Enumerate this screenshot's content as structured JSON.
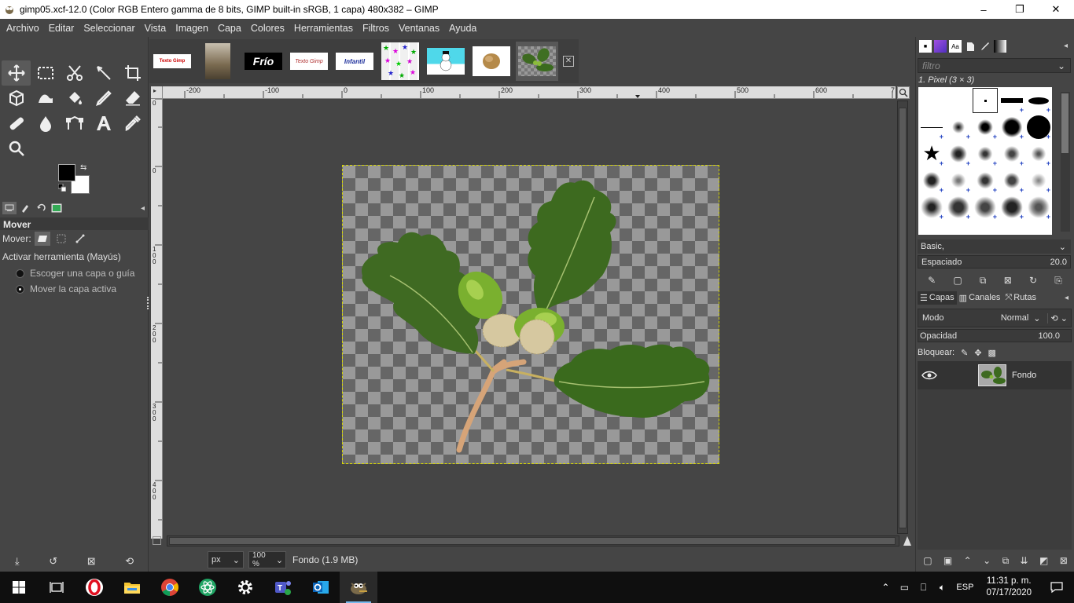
{
  "window": {
    "title": "gimp05.xcf-12.0 (Color RGB Entero gamma de 8 bits, GIMP built-in sRGB, 1 capa) 480x382 – GIMP",
    "minimize": "–",
    "maximize": "❐",
    "close": "✕"
  },
  "menu": [
    "Archivo",
    "Editar",
    "Seleccionar",
    "Vista",
    "Imagen",
    "Capa",
    "Colores",
    "Herramientas",
    "Filtros",
    "Ventanas",
    "Ayuda"
  ],
  "image_tabs": [
    {
      "label": "Texto Gimp",
      "bg": "#ffffff",
      "fg": "#cc0000"
    },
    {
      "label": "",
      "bg": "#8a7a60",
      "fg": "#fff"
    },
    {
      "label": "Frío",
      "bg": "#000000",
      "fg": "#ffffff"
    },
    {
      "label": "Texto Gimp",
      "bg": "#ffffff",
      "fg": "#b03030"
    },
    {
      "label": "Infantil",
      "bg": "#ffffff",
      "fg": "#1a2c9a"
    },
    {
      "label": "",
      "bg": "#f0f0f0",
      "fg": "#000"
    },
    {
      "label": "",
      "bg": "#3fd0e0",
      "fg": "#000"
    },
    {
      "label": "",
      "bg": "#ffffff",
      "fg": "#000"
    },
    {
      "label": "",
      "bg": "#777777",
      "fg": "#000"
    }
  ],
  "tool_options": {
    "title": "Mover",
    "mover_label": "Mover:",
    "activate_label": "Activar herramienta  (Mayús)",
    "radio_1": "Escoger una capa o guía",
    "radio_2": "Mover la capa activa"
  },
  "rulers": {
    "h_ticks": [
      "-200",
      "-100",
      "0",
      "100",
      "200",
      "300",
      "400",
      "500",
      "600",
      "7"
    ],
    "v_ticks": [
      "0",
      "0",
      "100",
      "200",
      "300",
      "400"
    ]
  },
  "status": {
    "unit": "px",
    "zoom": "100 %",
    "info": "Fondo (1.9 MB)"
  },
  "brushes": {
    "filter_placeholder": "filtro",
    "brush_name": "1. Pixel (3 × 3)",
    "preset": "Basic,",
    "spacing_label": "Espaciado",
    "spacing_value": "20.0"
  },
  "layers": {
    "tabs": [
      "Capas",
      "Canales",
      "Rutas"
    ],
    "mode_label": "Modo",
    "mode_value": "Normal",
    "opacity_label": "Opacidad",
    "opacity_value": "100.0",
    "lock_label": "Bloquear:",
    "items": [
      {
        "name": "Fondo"
      }
    ]
  },
  "taskbar": {
    "time": "11:31 p. m.",
    "date": "07/17/2020",
    "lang": "ESP"
  },
  "colors": {
    "foreground": "#000000",
    "background": "#ffffff",
    "selection_border": "#d8d800"
  }
}
